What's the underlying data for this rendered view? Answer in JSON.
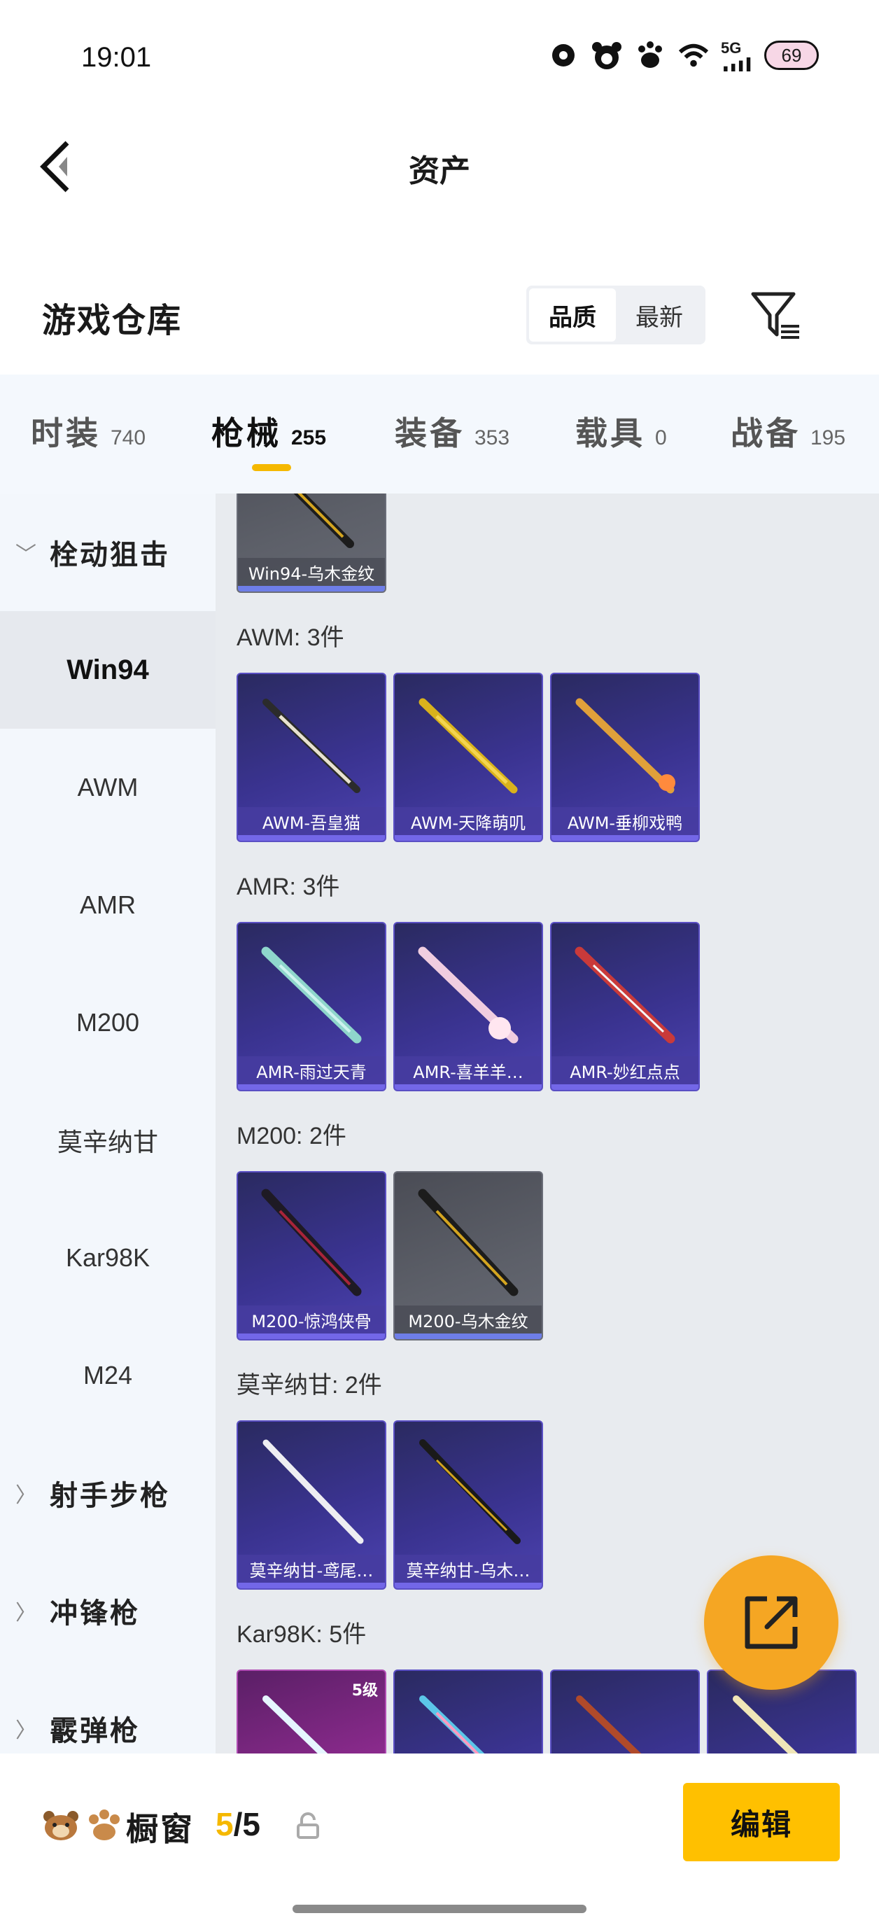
{
  "status_bar": {
    "time": "19:01",
    "network": "5G",
    "battery": "69"
  },
  "header": {
    "title": "资产"
  },
  "warehouse": {
    "title": "游戏仓库",
    "sort_options": [
      "品质",
      "最新"
    ],
    "sort_active": "品质"
  },
  "tabs": [
    {
      "label": "时装",
      "count": "740"
    },
    {
      "label": "枪械",
      "count": "255",
      "active": true
    },
    {
      "label": "装备",
      "count": "353"
    },
    {
      "label": "载具",
      "count": "0"
    },
    {
      "label": "战备",
      "count": "195"
    }
  ],
  "sidebar": {
    "categories": [
      {
        "label": "栓动狙击",
        "expanded": true
      },
      {
        "label": "射手步枪",
        "expanded": false
      },
      {
        "label": "冲锋枪",
        "expanded": false
      },
      {
        "label": "霰弹枪",
        "expanded": false
      }
    ],
    "items": [
      "Win94",
      "AWM",
      "AMR",
      "M200",
      "莫辛纳甘",
      "Kar98K",
      "M24"
    ],
    "active_item": "Win94"
  },
  "groups": [
    {
      "title": "",
      "items": [
        {
          "name": "Win94-乌木金纹",
          "style": "grey"
        }
      ]
    },
    {
      "title": "AWM: 3件",
      "items": [
        {
          "name": "AWM-吾皇猫",
          "style": "blue"
        },
        {
          "name": "AWM-天降萌叽",
          "style": "blue"
        },
        {
          "name": "AWM-垂柳戏鸭",
          "style": "blue"
        }
      ]
    },
    {
      "title": "AMR: 3件",
      "items": [
        {
          "name": "AMR-雨过天青",
          "style": "blue"
        },
        {
          "name": "AMR-喜羊羊…",
          "style": "blue"
        },
        {
          "name": "AMR-妙红点点",
          "style": "blue"
        }
      ]
    },
    {
      "title": "M200: 2件",
      "items": [
        {
          "name": "M200-惊鸿侠骨",
          "style": "blue"
        },
        {
          "name": "M200-乌木金纹",
          "style": "grey"
        }
      ]
    },
    {
      "title": "莫辛纳甘: 2件",
      "items": [
        {
          "name": "莫辛纳甘-鸢尾…",
          "style": "blue"
        },
        {
          "name": "莫辛纳甘-乌木…",
          "style": "blue"
        }
      ]
    },
    {
      "title": "Kar98K: 5件",
      "items": [
        {
          "name": "",
          "style": "purple5",
          "level": "5级"
        },
        {
          "name": "",
          "style": "blue"
        },
        {
          "name": "",
          "style": "blue"
        },
        {
          "name": "",
          "style": "blue"
        }
      ]
    }
  ],
  "bottom_bar": {
    "label": "橱窗",
    "count_current": "5",
    "count_separator": "/",
    "count_total": "5",
    "edit_label": "编辑"
  },
  "colors": {
    "accent": "#f5b800",
    "fab": "#f5a623",
    "card_blue": "#3a3390",
    "card_grey": "#5d6069"
  }
}
